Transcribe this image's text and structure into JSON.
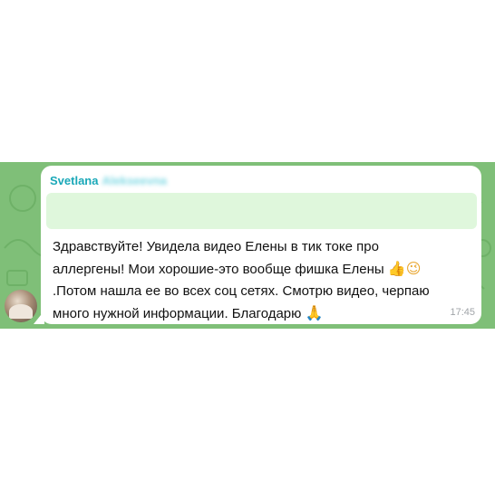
{
  "message": {
    "sender_first": "Svetlana",
    "sender_last": "Alekseevna",
    "line1": "Здравствуйте! Увидела видео Елены в тик токе про",
    "line2": "аллергены! Мои хорошие-это вообще фишка Елены",
    "line3": ".Потом нашла ее во всех соц сетях. Смотрю видео, черпаю",
    "line4": "много нужной информации. Благодарю",
    "emoji_thumbs": "👍",
    "emoji_wink": "😉",
    "emoji_pray": "🙏",
    "time": "17:45"
  },
  "colors": {
    "chat_background": "#7fbf78",
    "sender_name": "#1aa8b8",
    "reply_preview": "#dff7dc"
  },
  "icons": [
    "avatar",
    "thumbs-up-icon",
    "wink-emoji-icon",
    "praying-hands-icon"
  ]
}
